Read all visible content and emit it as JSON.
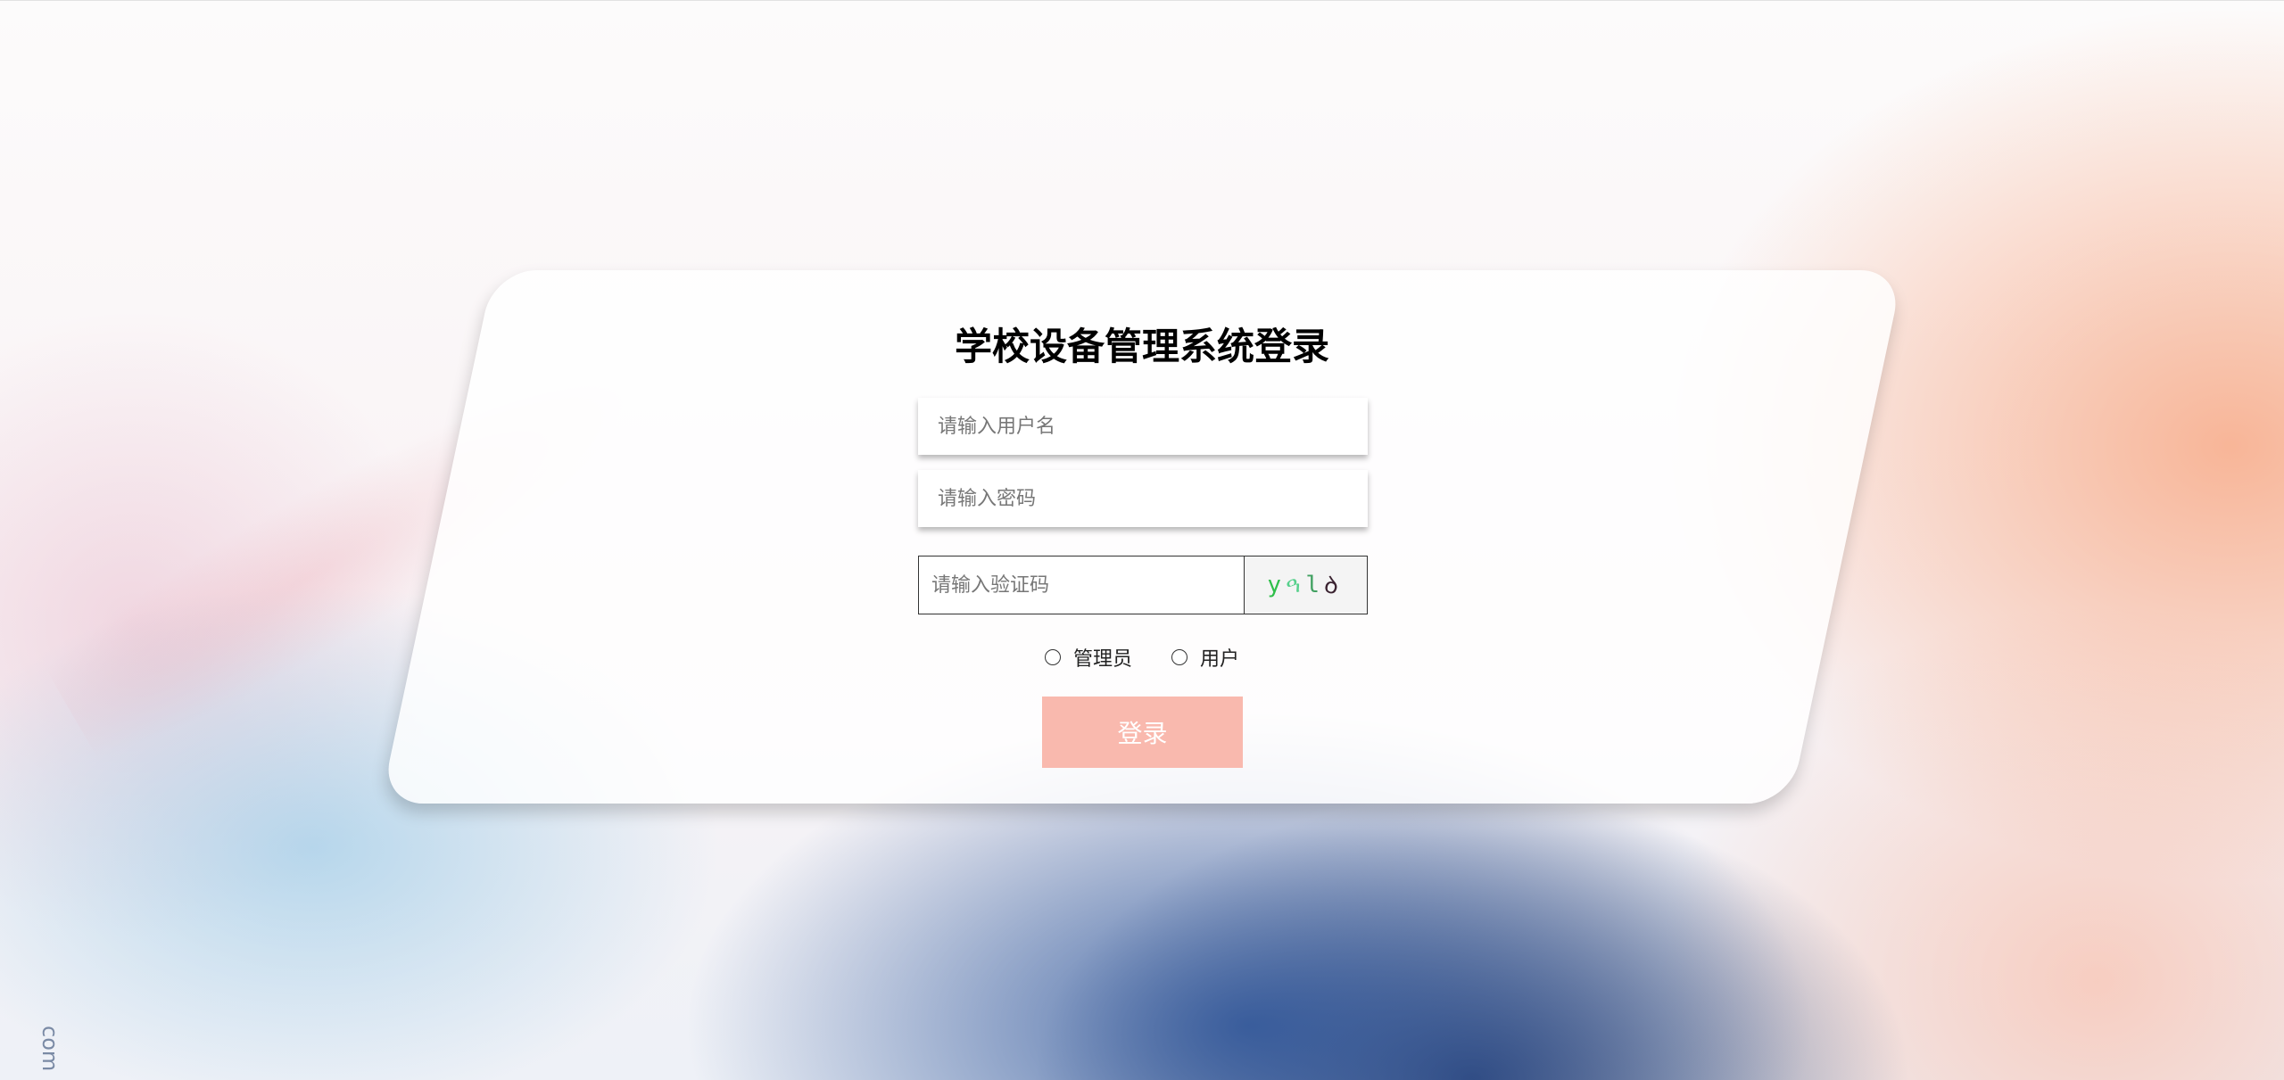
{
  "page": {
    "title": "学校设备管理系统登录",
    "watermark": "com"
  },
  "form": {
    "username_placeholder": "请输入用户名",
    "password_placeholder": "请输入密码",
    "captcha_placeholder": "请输入验证码",
    "captcha_chars": [
      "y",
      "ዓ",
      "l",
      "ꝺ"
    ],
    "roles": [
      {
        "label": "管理员",
        "selected": false
      },
      {
        "label": "用户",
        "selected": false
      }
    ],
    "login_label": "登录"
  },
  "colors": {
    "login_button_bg": "#f9b9ae",
    "login_button_text": "#ffffff",
    "card_bg": "#ffffff"
  }
}
